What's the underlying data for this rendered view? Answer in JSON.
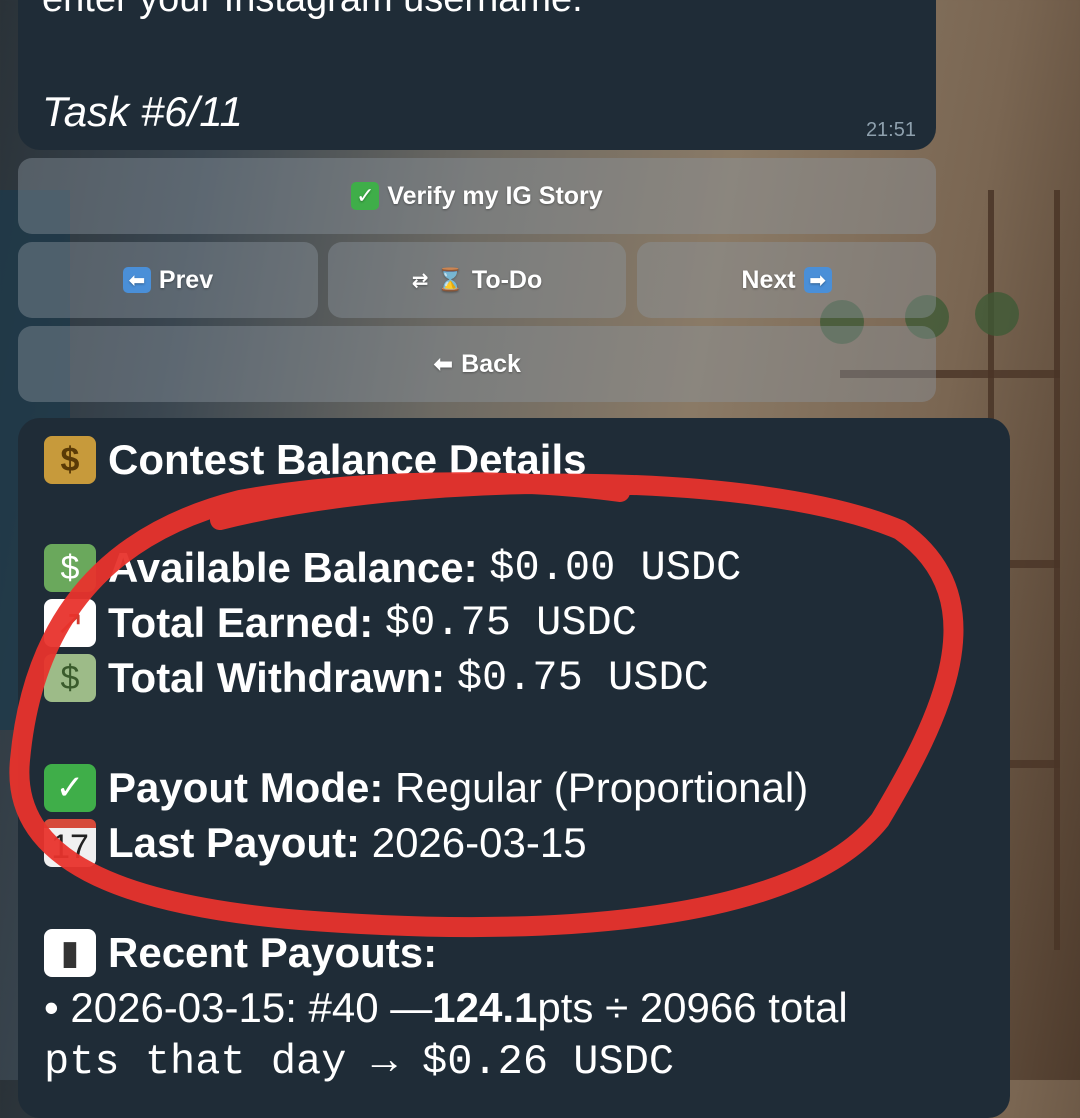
{
  "message": {
    "first_line": "enter your Instagram username.",
    "task": "Task #6/11",
    "time": "21:51"
  },
  "keyboard": {
    "verify_label": "Verify my IG Story",
    "prev_label": "Prev",
    "todo_label": "To-Do",
    "next_label": "Next",
    "back_label": "Back"
  },
  "card": {
    "title": "Contest Balance Details",
    "available_label": "Available Balance:",
    "available_value": "$0.00 USDC",
    "earned_label": "Total Earned:",
    "earned_value": "$0.75 USDC",
    "withdrawn_label": "Total Withdrawn:",
    "withdrawn_value": "$0.75 USDC",
    "payout_mode_label": "Payout Mode:",
    "payout_mode_value": "Regular (Proportional)",
    "last_payout_label": "Last Payout:",
    "last_payout_value": "2026-03-15",
    "recent_label": "Recent Payouts:",
    "recent_line1_prefix": "• 2026-03-15: #40 — ",
    "recent_line1_pts": "124.1",
    "recent_line1_suffix": " pts ÷ 20966 total",
    "recent_line2": "pts that day → $0.26 USDC"
  },
  "icons": {
    "verify": "check-icon",
    "prev": "left-arrow-icon",
    "todo": "hourglass-icon",
    "next": "right-arrow-icon",
    "back": "back-arrow-icon",
    "title": "money-bag-icon",
    "available": "dollar-bill-icon",
    "earned": "chart-up-icon",
    "withdrawn": "money-wings-icon",
    "payout_mode": "check-icon",
    "last_payout": "calendar-icon",
    "recent": "bar-chart-icon"
  },
  "colors": {
    "bubble": "#1f2c37",
    "annotation": "#e8332c",
    "button": "rgba(140,150,160,0.42)"
  },
  "annotation": "red hand-drawn ellipse"
}
